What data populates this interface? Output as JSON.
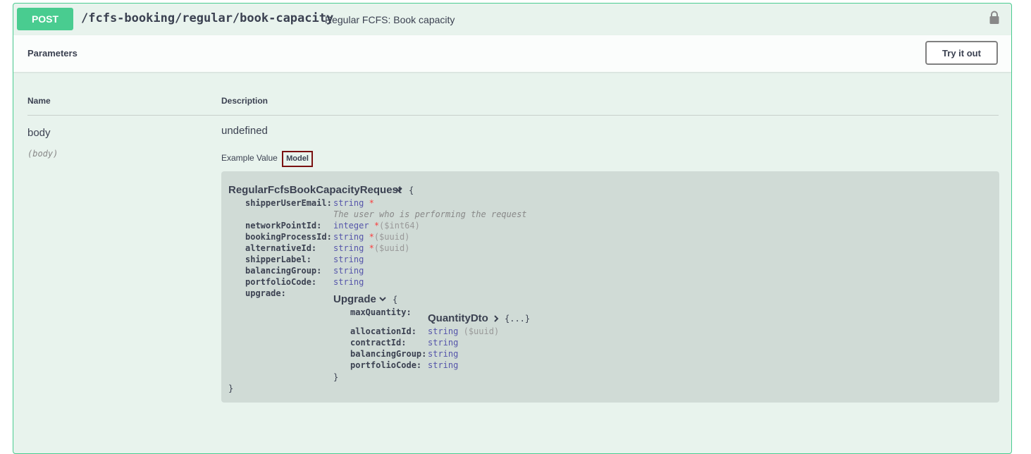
{
  "operation": {
    "method": "POST",
    "path": "/fcfs-booking/regular/book-capacity",
    "summary": "Regular FCFS: Book capacity"
  },
  "parameters": {
    "title": "Parameters",
    "try_button": "Try it out",
    "col_name": "Name",
    "col_description": "Description",
    "param_name": "body",
    "param_in": "(body)",
    "param_desc": "undefined",
    "tab_example": "Example Value",
    "tab_model": "Model"
  },
  "model": {
    "name": "RegularFcfsBookCapacityRequest",
    "open_brace": "{",
    "close_brace": "}",
    "props": [
      {
        "name": "shipperUserEmail:",
        "type": "string",
        "required": "*",
        "format": "",
        "desc": "The user who is performing the request"
      },
      {
        "name": "networkPointId:",
        "type": "integer",
        "required": "*",
        "format": "($int64)"
      },
      {
        "name": "bookingProcessId:",
        "type": "string",
        "required": "*",
        "format": "($uuid)"
      },
      {
        "name": "alternativeId:",
        "type": "string",
        "required": "*",
        "format": "($uuid)"
      },
      {
        "name": "shipperLabel:",
        "type": "string"
      },
      {
        "name": "balancingGroup:",
        "type": "string"
      },
      {
        "name": "portfolioCode:",
        "type": "string"
      },
      {
        "name": "upgrade:"
      }
    ],
    "upgrade": {
      "name": "Upgrade",
      "open_brace": "{",
      "close_brace": "}",
      "props": [
        {
          "name": "maxQuantity:",
          "ref": "QuantityDto",
          "collapsed": "{...}"
        },
        {
          "name": "allocationId:",
          "type": "string",
          "format": "($uuid)"
        },
        {
          "name": "contractId:",
          "type": "string"
        },
        {
          "name": "balancingGroup:",
          "type": "string"
        },
        {
          "name": "portfolioCode:",
          "type": "string"
        }
      ]
    }
  },
  "colors": {
    "post_green": "#49cc90",
    "block_bg": "#e8f3ed",
    "model_bg": "#d0dbd6",
    "type_blue": "#5555aa",
    "required_red": "#f93e3e",
    "tab_focus": "#7a1111"
  }
}
